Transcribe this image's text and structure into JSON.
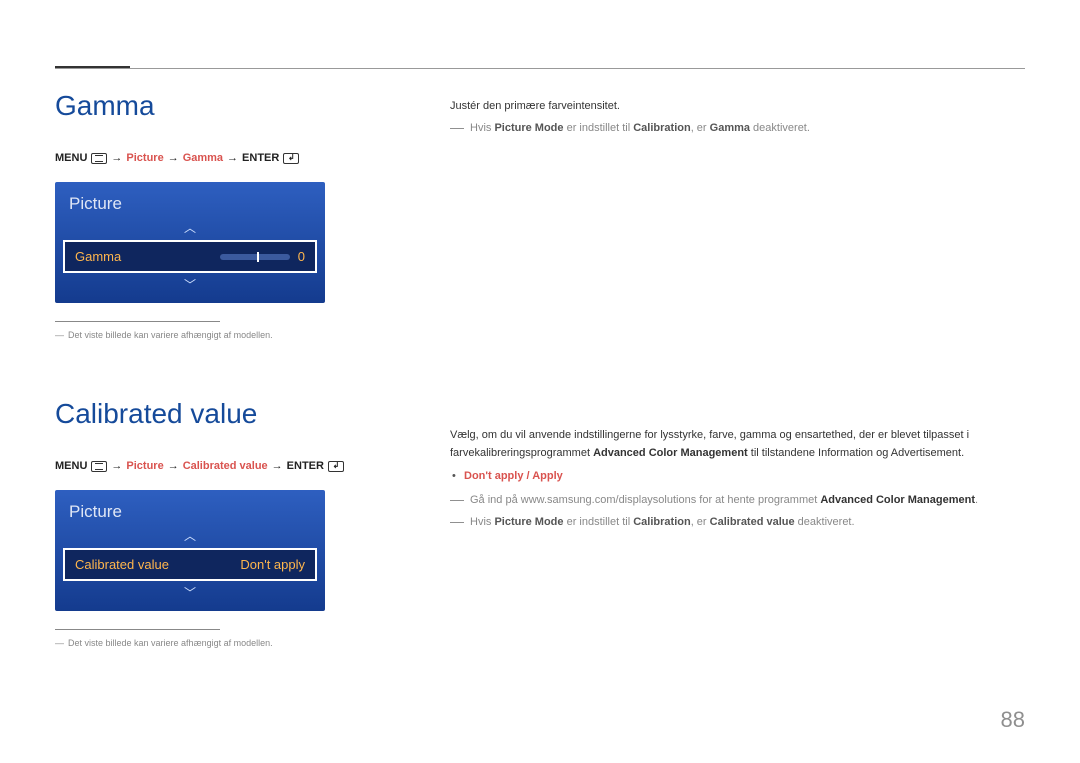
{
  "page_number": "88",
  "section1": {
    "heading": "Gamma",
    "breadcrumb": {
      "menu_label": "MENU",
      "p1": "Picture",
      "p2": "Gamma",
      "enter_label": "ENTER"
    },
    "osd": {
      "title": "Picture",
      "row_label": "Gamma",
      "row_value": "0"
    },
    "note": "Det viste billede kan variere afhængigt af modellen.",
    "body": {
      "line1": "Justér den primære farveintensitet.",
      "note_pre": "Hvis ",
      "note_b1": "Picture Mode",
      "note_mid": " er indstillet til ",
      "note_b2": "Calibration",
      "note_mid2": ", er ",
      "note_b3": "Gamma",
      "note_end": " deaktiveret."
    }
  },
  "section2": {
    "heading": "Calibrated value",
    "breadcrumb": {
      "menu_label": "MENU",
      "p1": "Picture",
      "p2": "Calibrated value",
      "enter_label": "ENTER"
    },
    "osd": {
      "title": "Picture",
      "row_label": "Calibrated value",
      "row_value": "Don't apply"
    },
    "note": "Det viste billede kan variere afhængigt af modellen.",
    "body": {
      "para_a": "Vælg, om du vil anvende indstillingerne for lysstyrke, farve, gamma og ensartethed, der er blevet tilpasset i farvekalibreringsprogrammet ",
      "para_b_bold": "Advanced Color Management",
      "para_c": " til tilstandene Information og Advertisement.",
      "bullet": "Don't apply / Apply",
      "note1_pre": "Gå ind på www.samsung.com/displaysolutions for at hente programmet ",
      "note1_bold": "Advanced Color Management",
      "note1_end": ".",
      "note2_pre": "Hvis ",
      "note2_b1": "Picture Mode",
      "note2_mid": " er indstillet til ",
      "note2_b2": "Calibration",
      "note2_mid2": ", er ",
      "note2_b3": "Calibrated value",
      "note2_end": " deaktiveret."
    }
  }
}
